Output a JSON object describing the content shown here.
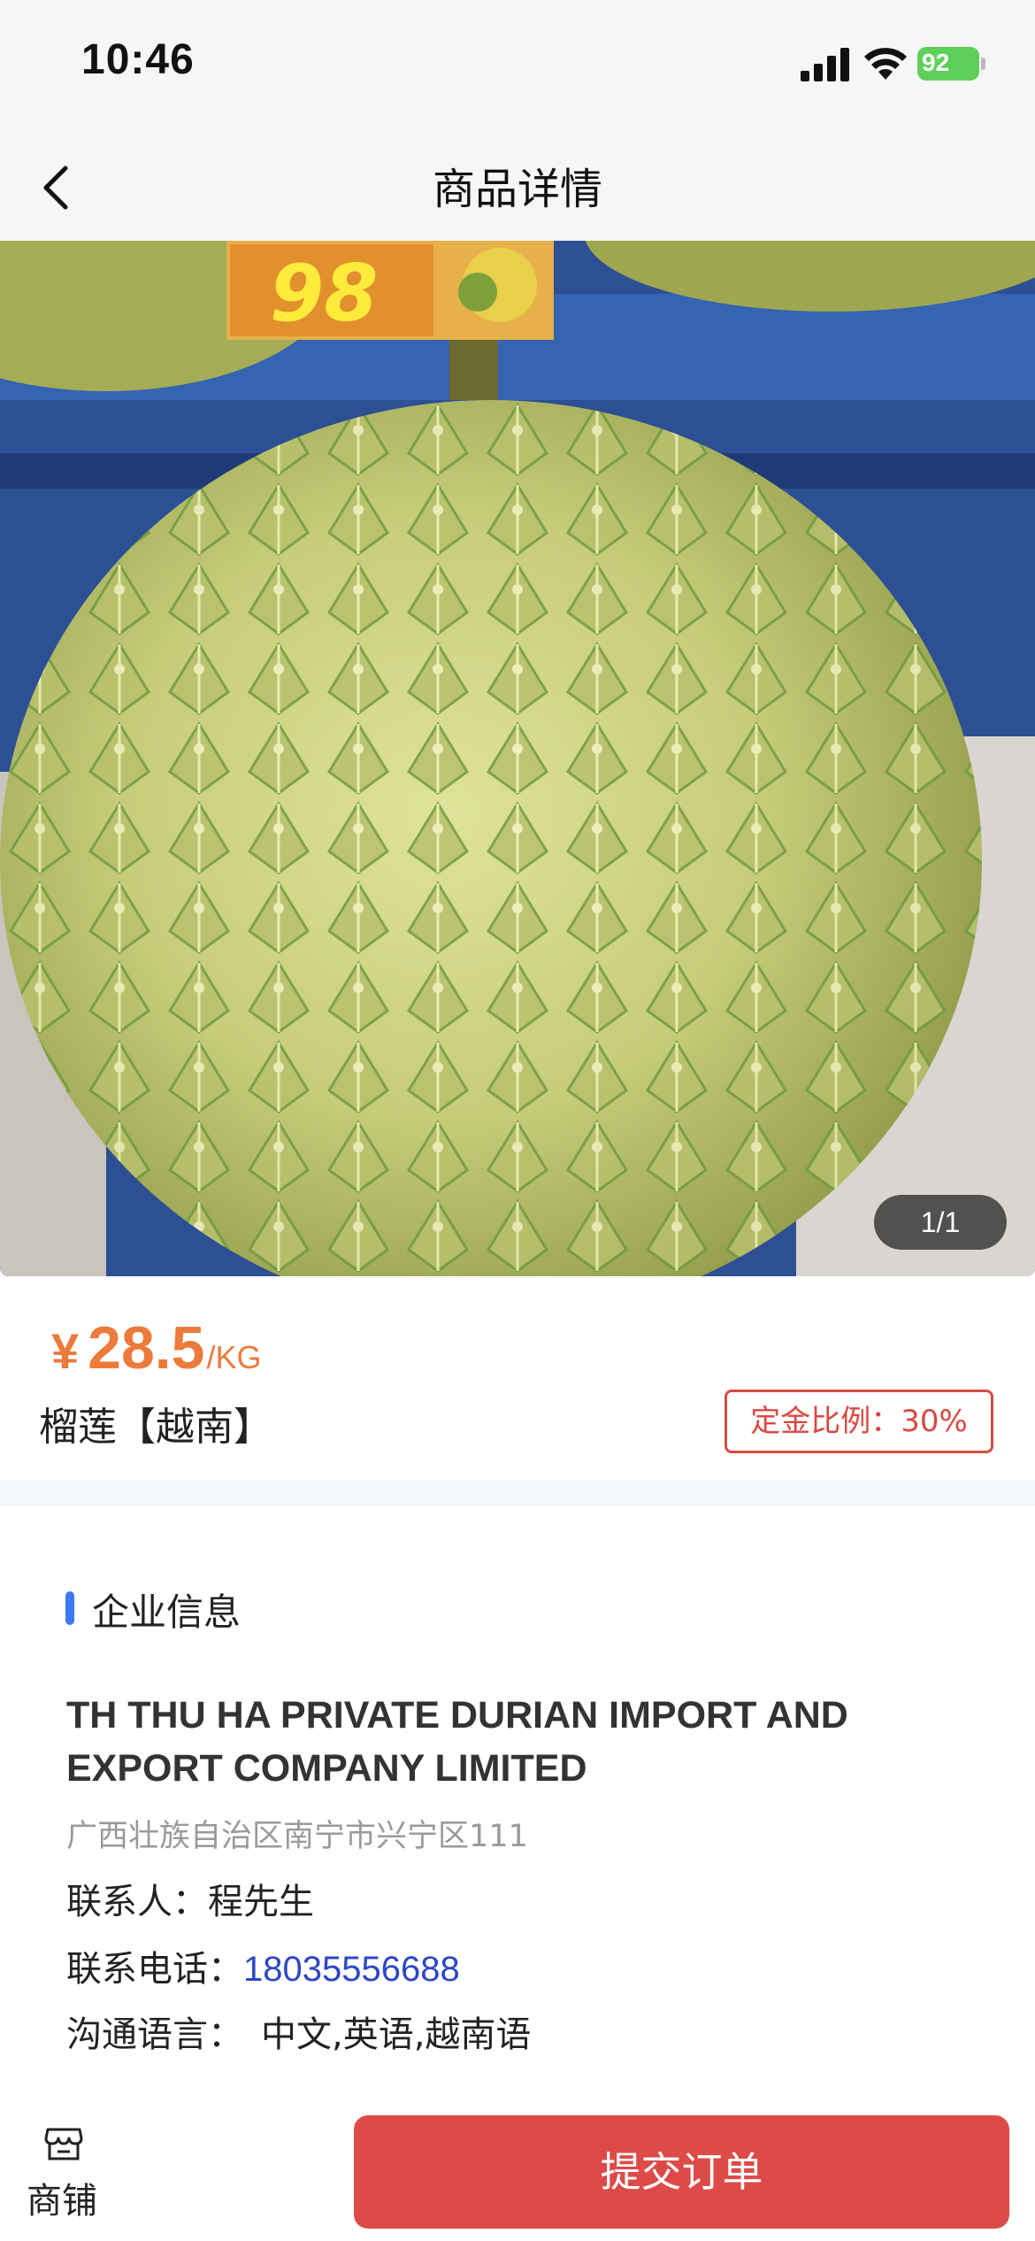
{
  "status_bar": {
    "time": "10:46",
    "battery": "92",
    "icons": [
      "signal-icon",
      "wifi-icon",
      "battery-icon"
    ]
  },
  "nav": {
    "title": "商品详情",
    "back_icon": "chevron-left-icon"
  },
  "product": {
    "image_counter": "1/1",
    "image_tag_text": "98",
    "currency": "¥",
    "price": "28.5",
    "unit": "/KG",
    "name": "榴莲【越南】",
    "deposit": "定金比例：30%"
  },
  "company": {
    "section_title": "企业信息",
    "name": "TH THU HA PRIVATE DURIAN IMPORT AND EXPORT COMPANY LIMITED",
    "address": "广西壮族自治区南宁市兴宁区111",
    "contact_label": "联系人：",
    "contact_value": "程先生",
    "phone_label": "联系电话：",
    "phone_value": "18035556688",
    "language_label": "沟通语言：",
    "language_value": "中文,英语,越南语"
  },
  "bottom_bar": {
    "shop_label": "商铺",
    "shop_icon": "store-icon",
    "submit_label": "提交订单"
  },
  "colors": {
    "price": "#ec7a3b",
    "deposit": "#d84a43",
    "accent_bar": "#3b7af0",
    "phone": "#2e47c5",
    "submit_button": "#dd4b48"
  }
}
